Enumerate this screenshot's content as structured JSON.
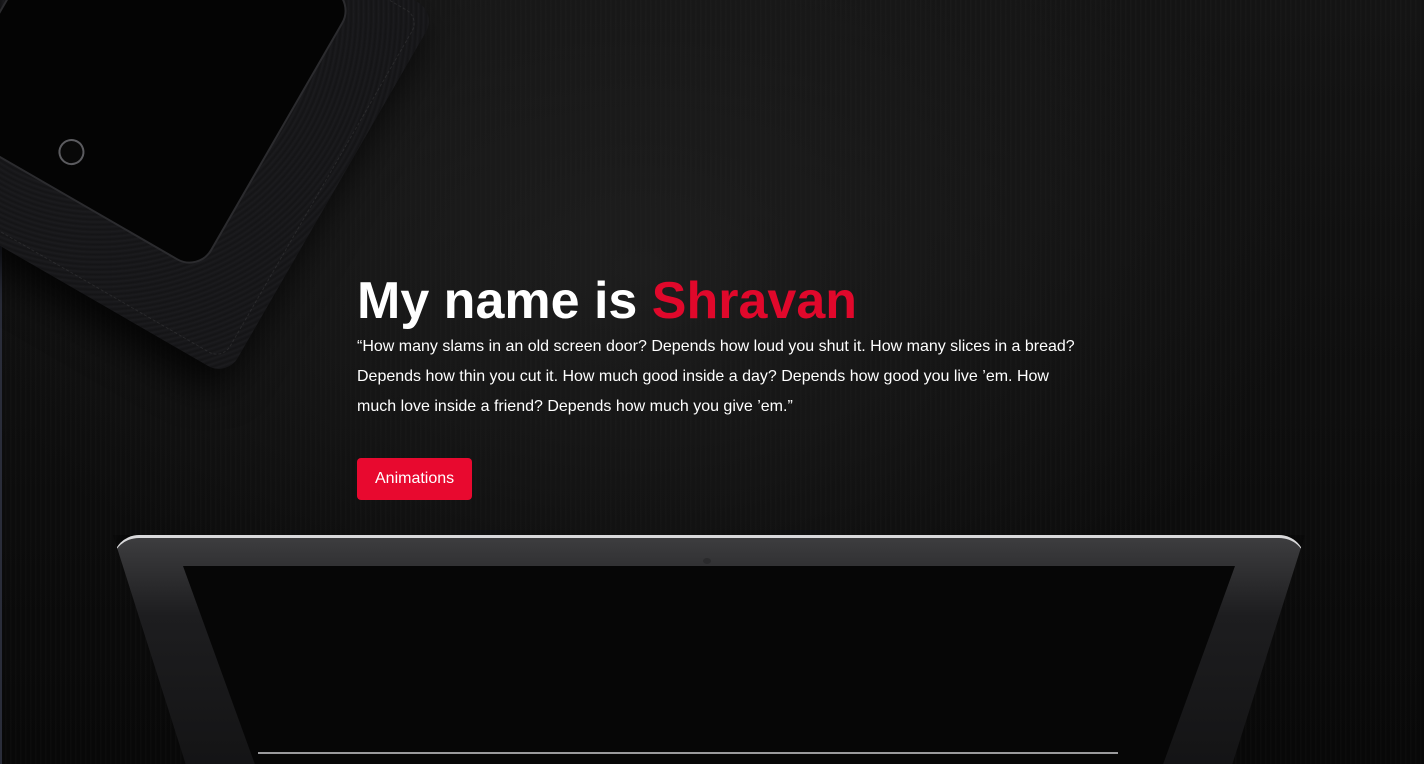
{
  "hero": {
    "headline_prefix": "My name is ",
    "headline_name": "Shravan",
    "quote": "“How many slams in an old screen door? Depends how loud you shut it. How many slices in a bread? Depends how thin you cut it. How much good inside a day? Depends how good you live ’em. How much love inside a friend? Depends how much you give ’em.”",
    "button_label": "Animations"
  },
  "colors": {
    "accent": "#e0082b",
    "button": "#e8092f",
    "background": "#0b0b0b",
    "text": "#ffffff"
  }
}
